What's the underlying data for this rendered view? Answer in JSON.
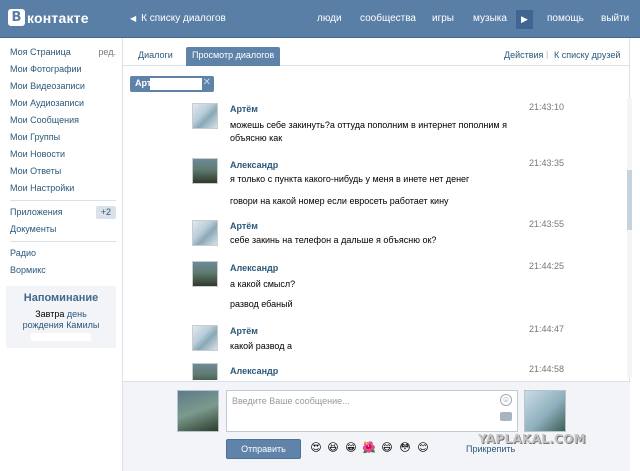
{
  "header": {
    "logo_letter": "В",
    "logo_text": "контакте",
    "back_link": "К списку диалогов",
    "nav": [
      "люди",
      "сообщества",
      "игры",
      "музыка",
      "помощь",
      "выйти"
    ],
    "brand_color": "#5a7fa7"
  },
  "sidebar": {
    "items": [
      {
        "label": "Моя Страница",
        "extra": "ред."
      },
      {
        "label": "Мои Фотографии"
      },
      {
        "label": "Мои Видеозаписи"
      },
      {
        "label": "Мои Аудиозаписи"
      },
      {
        "label": "Мои Сообщения"
      },
      {
        "label": "Мои Группы"
      },
      {
        "label": "Мои Новости"
      },
      {
        "label": "Мои Ответы"
      },
      {
        "label": "Мои Настройки"
      }
    ],
    "apps": {
      "label": "Приложения",
      "badge": "+2"
    },
    "docs": {
      "label": "Документы"
    },
    "extras": [
      {
        "label": "Радио"
      },
      {
        "label": "Вормикс"
      }
    ],
    "reminder": {
      "title": "Напоминание",
      "text_before": "Завтра",
      "text_link": "день рождения",
      "text_name": "Камилы"
    }
  },
  "tabs": {
    "dialogs": "Диалоги",
    "view": "Просмотр диалогов",
    "actions": "Действия",
    "to_friends": "К списку друзей"
  },
  "filter": {
    "name": "Арт",
    "close": "✕"
  },
  "messages": [
    {
      "author": "Артём",
      "time": "21:43:10",
      "lines": [
        "можешь себе закинуть?а оттуда пополним в интернет пополним я объясню как"
      ]
    },
    {
      "author": "Александр",
      "time": "21:43:35",
      "lines": [
        "я только с пункта какого-нибудь у меня в инете нет денег",
        "говори на какой номер если евросеть работает кину"
      ]
    },
    {
      "author": "Артём",
      "time": "21:43:55",
      "lines": [
        "себе закинь на телефон а дальше я объясню ок?"
      ]
    },
    {
      "author": "Александр",
      "time": "21:44:25",
      "lines": [
        "а какой смысл?",
        "развод ебаный"
      ]
    },
    {
      "author": "Артём",
      "time": "21:44:47",
      "lines": [
        "какой развод а"
      ]
    },
    {
      "author": "Александр",
      "time": "21:44:58",
      "lines": []
    }
  ],
  "composer": {
    "placeholder": "Введите Ваше сообщение...",
    "send_label": "Отправить",
    "attach_label": "Прикрепить",
    "emojis": [
      "😍",
      "😆",
      "😁",
      "🌺",
      "😄",
      "😳",
      "😊"
    ]
  },
  "watermark": "YAPLAKAL.COM"
}
